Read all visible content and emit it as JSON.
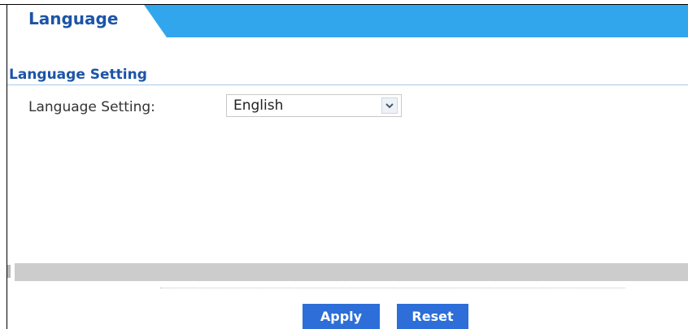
{
  "tabs": {
    "active_label": "Language"
  },
  "section": {
    "title": "Language Setting"
  },
  "form": {
    "language_label": "Language Setting:",
    "language_value": "English"
  },
  "actions": {
    "apply_label": "Apply",
    "reset_label": "Reset"
  },
  "colors": {
    "accent_blue": "#32a6ec",
    "title_blue": "#1c54a8",
    "button_blue": "#2d6ed8"
  },
  "icons": {
    "dropdown": "chevron-down-icon"
  }
}
